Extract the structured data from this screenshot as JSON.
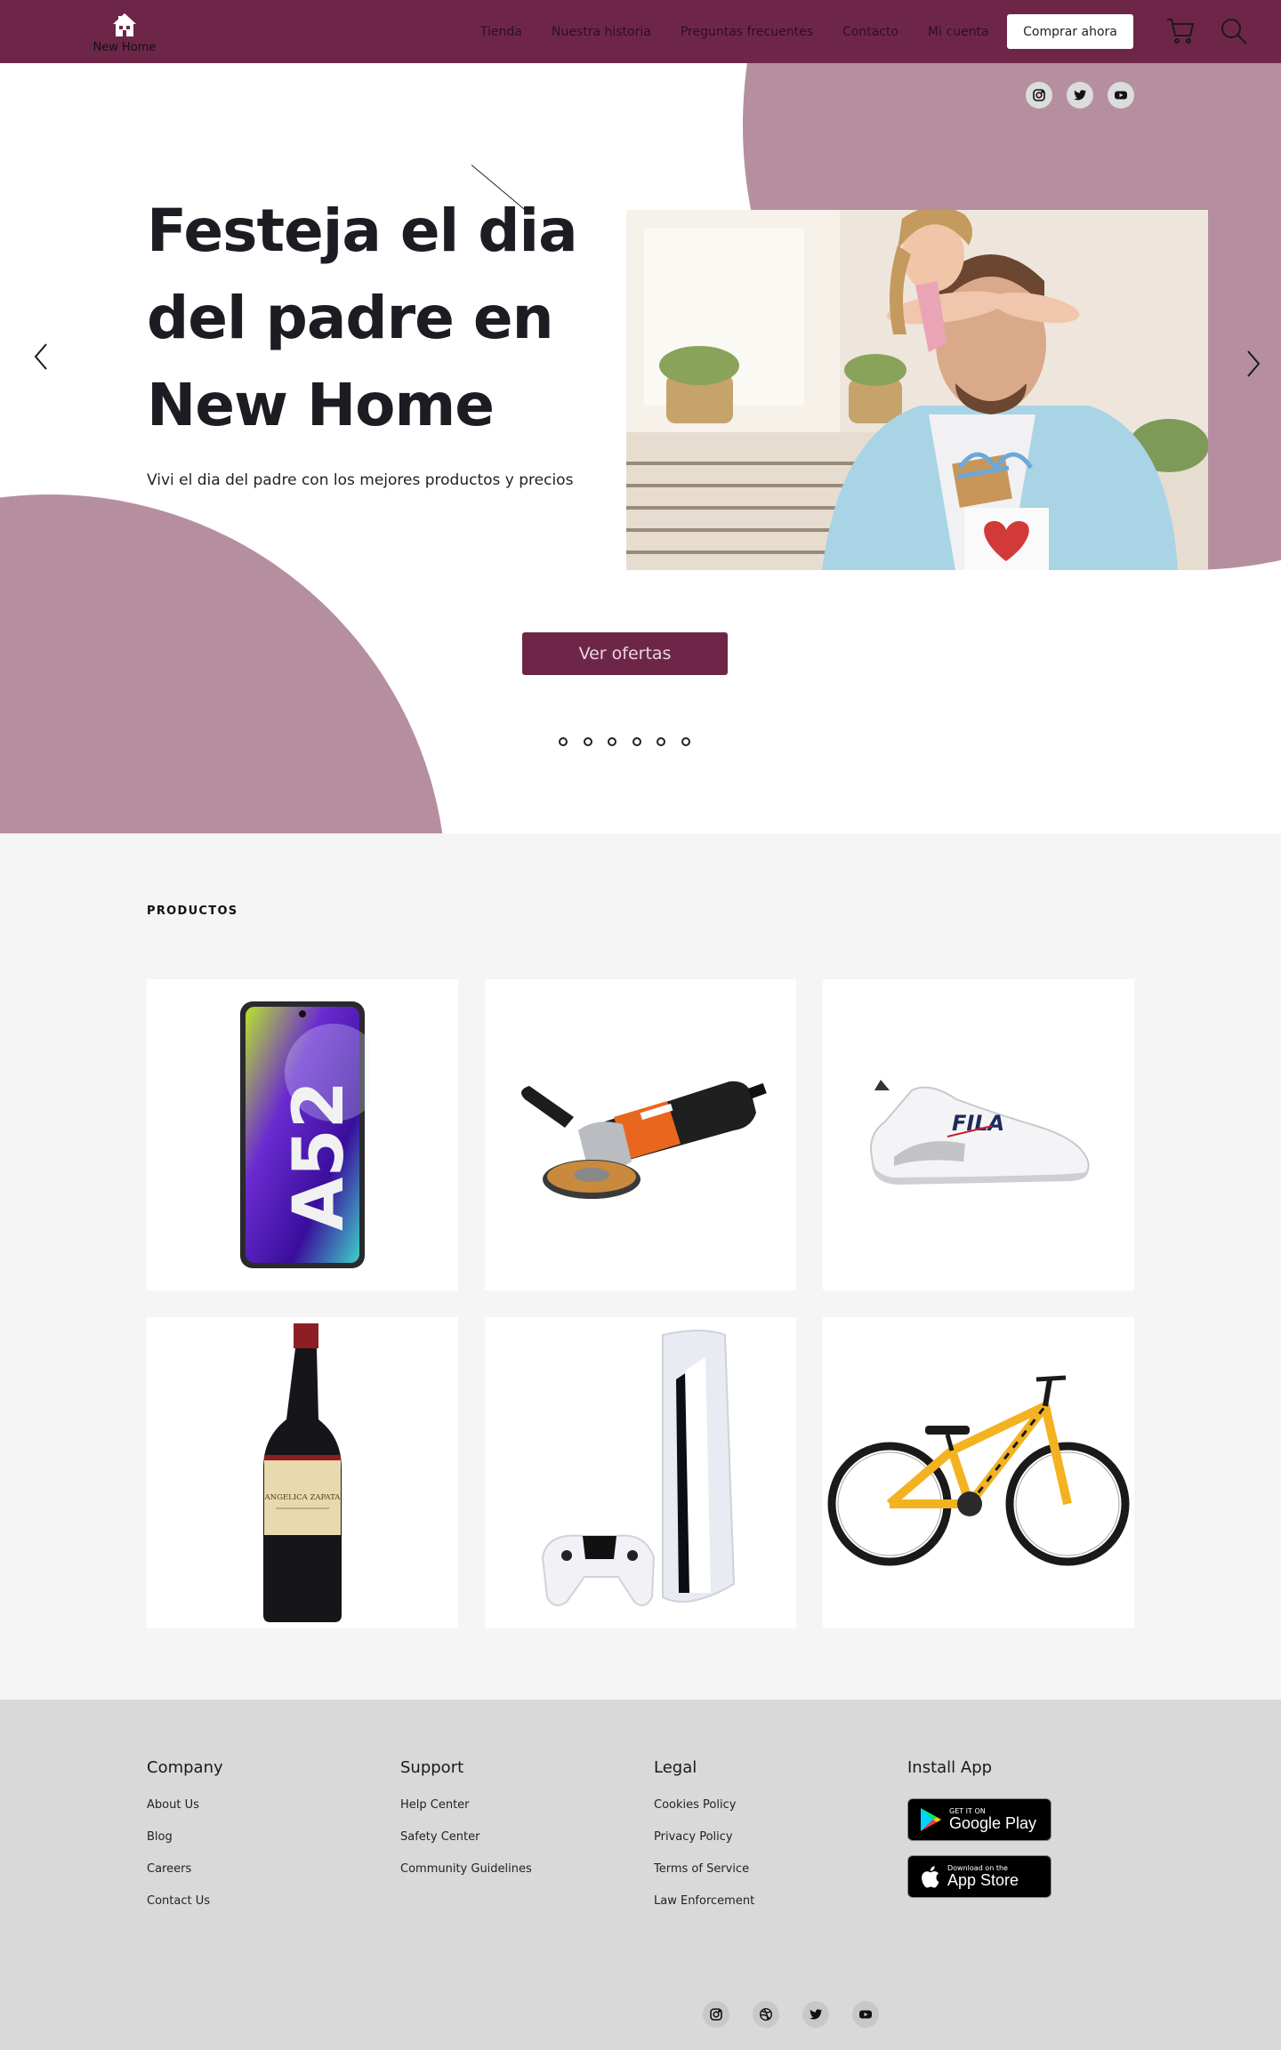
{
  "nav": {
    "logo_text": "New Home",
    "links": [
      "Tienda",
      "Nuestra historia",
      "Preguntas frecuentes",
      "Contacto",
      "Mi cuenta"
    ],
    "buy_button": "Comprar ahora",
    "icons": [
      "cart-icon",
      "search-icon"
    ]
  },
  "hero": {
    "title": "Festeja el dia del padre en New Home",
    "subtitle": "Vivi el dia del padre con los  mejores productos y precios",
    "cta": "Ver ofertas",
    "image_alt": "father-and-daughter-photo",
    "slide_count": 6,
    "social_icons": [
      "instagram-icon",
      "twitter-icon",
      "youtube-icon"
    ]
  },
  "products": {
    "title": "PRODUCTOS",
    "items": [
      {
        "name": "smartphone",
        "label_on_image": "A52"
      },
      {
        "name": "angle-grinder",
        "label_on_image": ""
      },
      {
        "name": "sneaker",
        "label_on_image": "FILA"
      },
      {
        "name": "wine-bottle",
        "label_on_image": "ANGELICA ZAPATA"
      },
      {
        "name": "game-console",
        "label_on_image": ""
      },
      {
        "name": "bicycle",
        "label_on_image": ""
      }
    ]
  },
  "footer": {
    "company": {
      "title": "Company",
      "links": [
        "About Us",
        "Blog",
        "Careers",
        "Contact Us"
      ]
    },
    "support": {
      "title": "Support",
      "links": [
        "Help Center",
        "Safety Center",
        "Community Guidelines"
      ]
    },
    "legal": {
      "title": "Legal",
      "links": [
        "Cookies Policy",
        "Privacy Policy",
        "Terms of Service",
        "Law Enforcement"
      ]
    },
    "install": {
      "title": "Install App",
      "google": {
        "small": "GET IT ON",
        "big": "Google Play"
      },
      "apple": {
        "small": "Download on the",
        "big": "App Store"
      }
    },
    "social_icons": [
      "instagram-icon",
      "dribbble-icon",
      "twitter-icon",
      "youtube-icon"
    ]
  },
  "colors": {
    "primary": "#6e2648",
    "accent_blob": "#b58f9f",
    "products_bg": "#f5f5f5",
    "footer_bg": "#d9d9d9"
  }
}
